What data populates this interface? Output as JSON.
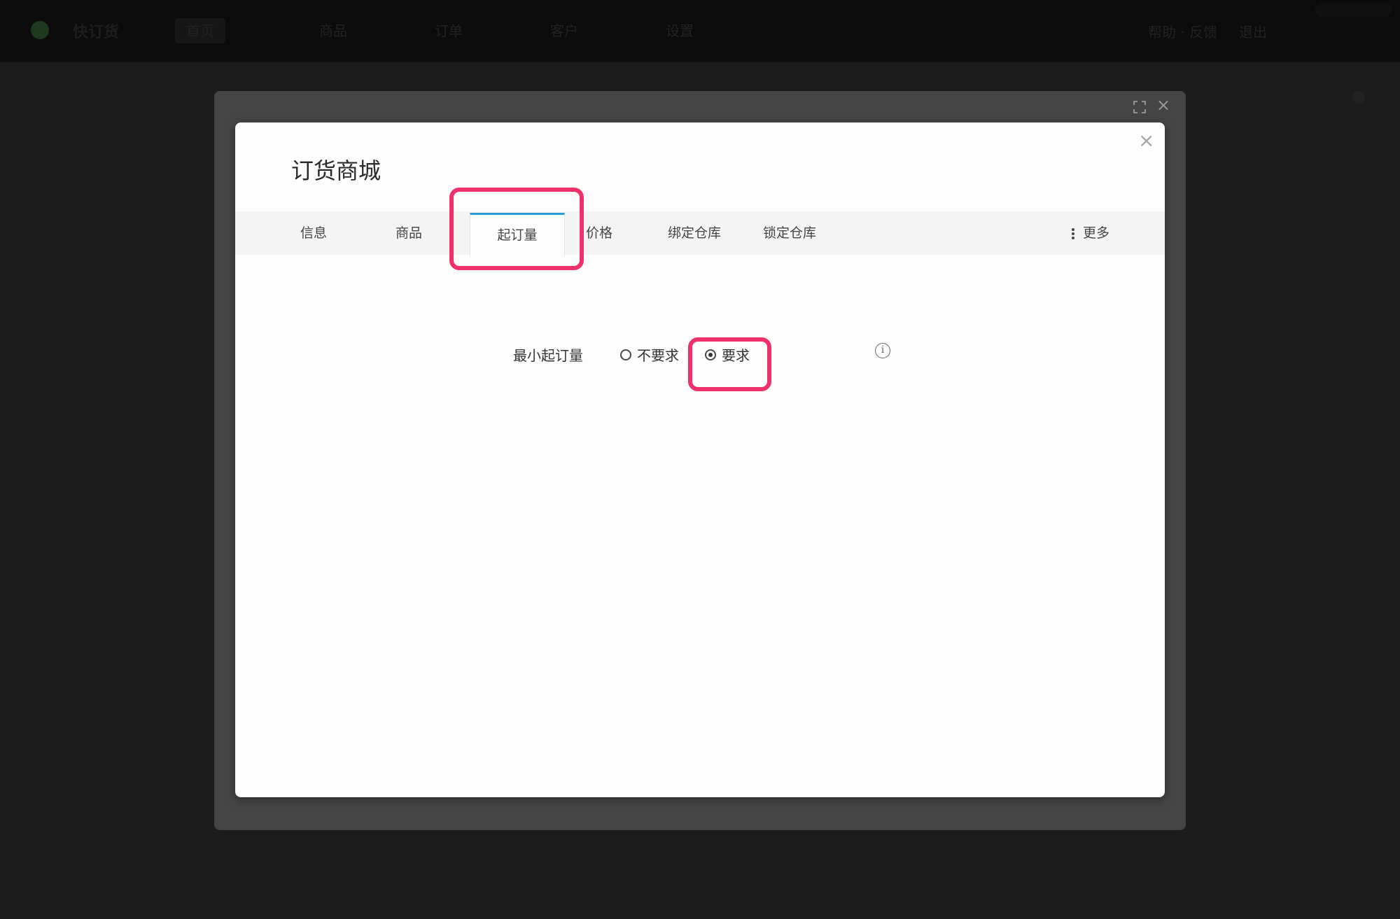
{
  "app": {
    "name": "快订货",
    "nav": [
      "首页",
      "商品",
      "订单",
      "客户",
      "设置"
    ],
    "top_right": [
      "帮助 · 反馈",
      "退出"
    ]
  },
  "modal": {
    "title": "订货商城",
    "close_glyph": "×",
    "outer_close_glyph": "×",
    "tabs": [
      {
        "label": "信息"
      },
      {
        "label": "商品"
      },
      {
        "label": "起订量",
        "active": true
      },
      {
        "label": "价格"
      },
      {
        "label": "绑定仓库"
      },
      {
        "label": "锁定仓库"
      }
    ],
    "more_label": "更多",
    "form": {
      "label": "最小起订量",
      "options": [
        {
          "label": "不要求",
          "checked": false
        },
        {
          "label": "要求",
          "checked": true
        }
      ],
      "info_glyph": "i"
    }
  },
  "colors": {
    "highlight": "#f0306b",
    "active_tab_border": "#2c9bd6"
  }
}
